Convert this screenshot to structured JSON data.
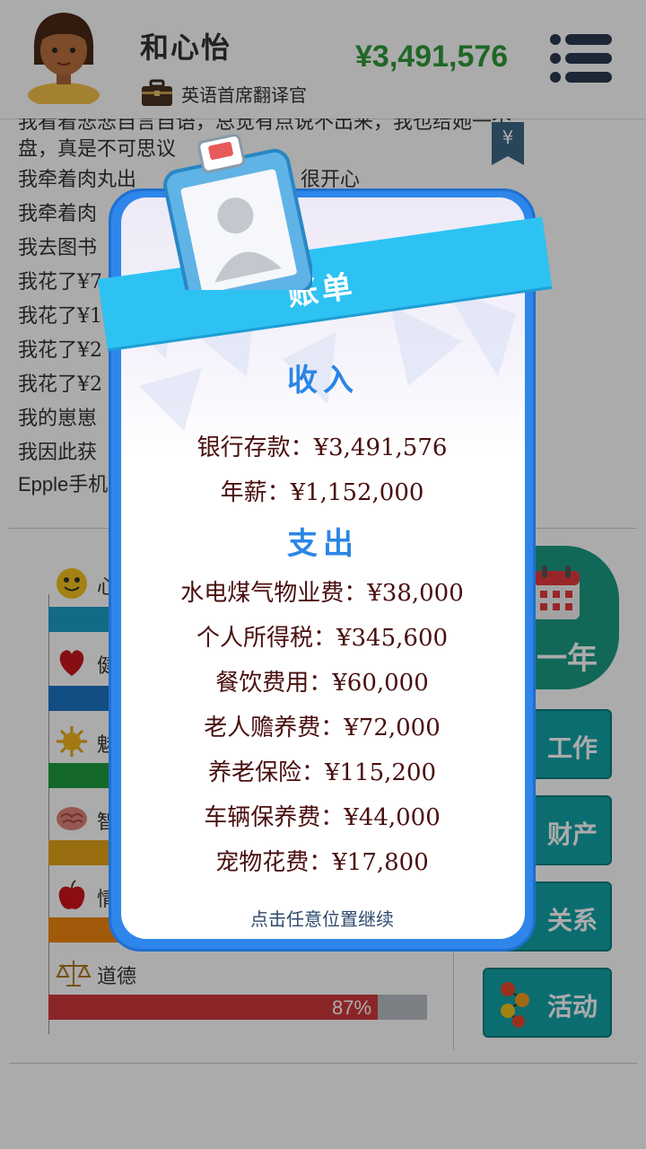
{
  "header": {
    "player_name": "和心怡",
    "job_title": "英语首席翻译官",
    "money": "¥3,491,576",
    "menu_icon": "hamburger-menu-icon"
  },
  "log": {
    "lines": [
      "我看着悲悲自言自语，总觉有点说不出来，我也给她一个",
      "盘，真是不可思议",
      "我牵着肉丸出",
      "我牵着肉",
      "我去图书",
      "我花了¥7",
      "我花了¥1",
      "我花了¥2",
      "我花了¥2",
      "我的崽崽",
      "我因此获",
      "Epple手机"
    ],
    "line2_tail": "很开心",
    "bookmark_icon": "yuan-bookmark-icon",
    "bookmark_symbol": "¥"
  },
  "stats": {
    "items": [
      {
        "label": "心",
        "icon": "smiley-face-icon",
        "color": "#1b9ec6",
        "fill": 1.0
      },
      {
        "label": "健",
        "icon": "heart-icon",
        "color": "#1b73c4",
        "fill": 1.0
      },
      {
        "label": "魅",
        "icon": "sun-icon",
        "color": "#1f9c3f",
        "fill": 1.0
      },
      {
        "label": "智",
        "icon": "brain-icon",
        "color": "#e3a51a",
        "fill": 1.0
      },
      {
        "label": "情",
        "icon": "apple-icon",
        "color": "#f0860f",
        "fill": 1.0
      },
      {
        "label": "道德",
        "icon": "scales-icon",
        "color": "#d0393d",
        "fill": 0.87,
        "pct": "87%"
      }
    ]
  },
  "actions": {
    "next_year": "一年",
    "next_year_icon": "calendar-icon",
    "work": "工作",
    "work_icon": "briefcase-icon",
    "assets": "财产",
    "assets_icon": "coins-icon",
    "relations": "关系",
    "relations_icon": "people-icon",
    "activities": "活动",
    "activities_icon": "network-icon"
  },
  "bill": {
    "title": "账单",
    "badge_icon": "id-badge-icon",
    "income_title": "收入",
    "income": [
      "银行存款：¥3,491,576",
      "年薪：¥1,152,000"
    ],
    "expense_title": "支出",
    "expenses": [
      "水电煤气物业费：¥38,000",
      "个人所得税：¥345,600",
      "餐饮费用：¥60,000",
      "老人赡养费：¥72,000",
      "养老保险：¥115,200",
      "车辆保养费：¥44,000",
      "宠物花费：¥17,800"
    ],
    "continue_hint": "点击任意位置继续"
  }
}
